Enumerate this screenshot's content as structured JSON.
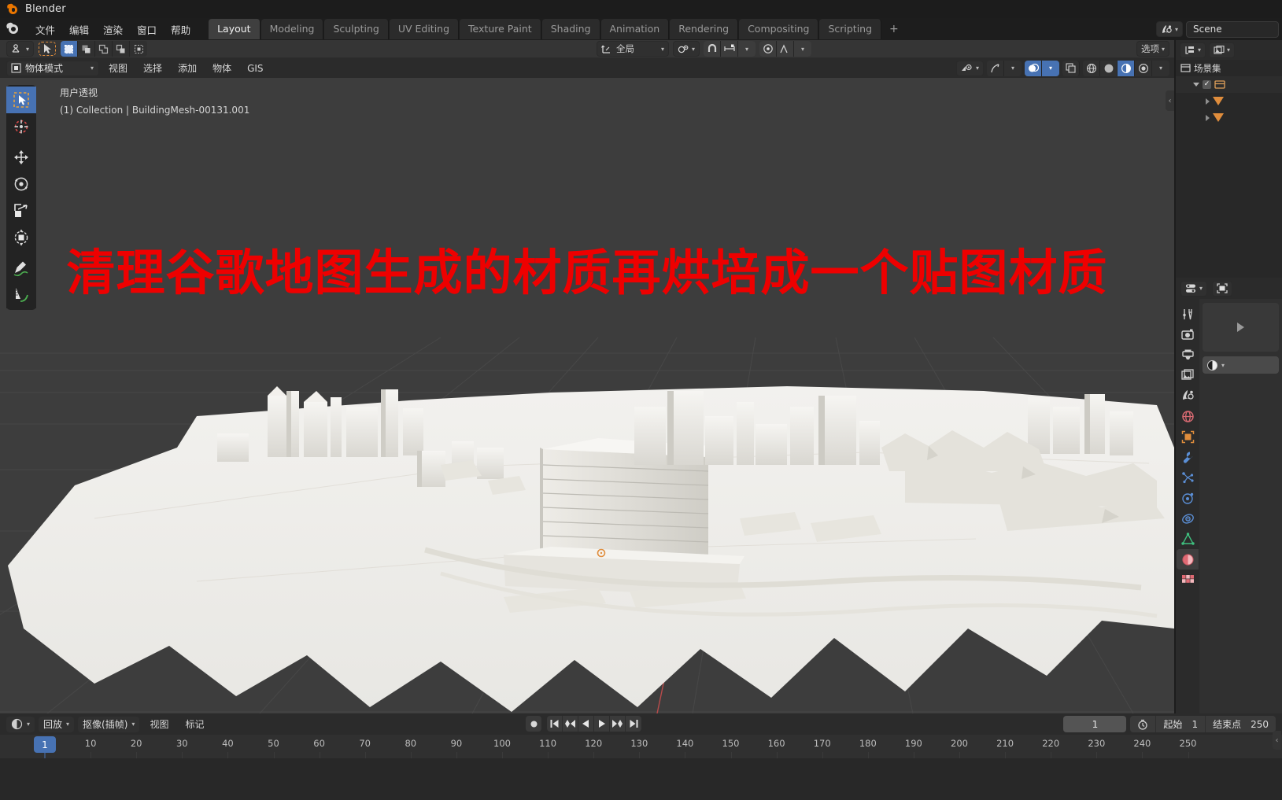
{
  "window": {
    "title": "Blender",
    "logo_icon": "blender-logo-icon"
  },
  "topbar": {
    "menus": [
      "文件",
      "编辑",
      "渲染",
      "窗口",
      "帮助"
    ],
    "workspace_tabs": [
      {
        "label": "Layout",
        "active": true
      },
      {
        "label": "Modeling",
        "active": false
      },
      {
        "label": "Sculpting",
        "active": false
      },
      {
        "label": "UV Editing",
        "active": false
      },
      {
        "label": "Texture Paint",
        "active": false
      },
      {
        "label": "Shading",
        "active": false
      },
      {
        "label": "Animation",
        "active": false
      },
      {
        "label": "Rendering",
        "active": false
      },
      {
        "label": "Compositing",
        "active": false
      },
      {
        "label": "Scripting",
        "active": false
      }
    ],
    "add_tab_label": "+",
    "scene_browse_icon": "scene-data-icon",
    "scene_name": "Scene"
  },
  "viewport": {
    "tool_settings": {
      "active_tool_icon": "tweak-tool-icon",
      "select_modes": [
        "select-new-icon",
        "select-extend-icon",
        "select-subtract-icon",
        "select-invert-icon",
        "select-intersect-icon"
      ],
      "transform_orientation": "全局",
      "transform_orientation_icon": "orientation-axis-icon",
      "pivot_icon": "pivot-point-icon",
      "snap_icon": "magnet-icon",
      "snap_to_icon": "snap-increment-icon",
      "proportional_icon": "proportional-edit-icon",
      "falloff_icon": "falloff-curve-icon",
      "options_label": "选项"
    },
    "header": {
      "mode": "物体模式",
      "mode_icon": "object-mode-icon",
      "menus": [
        "视图",
        "选择",
        "添加",
        "物体",
        "GIS"
      ],
      "visibility_icon": "eye-dropdown-icon",
      "gizmo_icon": "gizmo-icon",
      "overlays_icon": "overlays-icon",
      "xray_icon": "xray-toggle-icon",
      "shading_modes": [
        "wireframe-shading-icon",
        "solid-shading-icon",
        "material-shading-icon",
        "rendered-shading-icon"
      ],
      "active_shading": "material-shading-icon"
    },
    "toolbar": [
      {
        "icon": "select-box-tool-icon",
        "active": true
      },
      {
        "icon": "cursor-tool-icon",
        "active": false
      },
      {
        "icon": "move-tool-icon",
        "active": false
      },
      {
        "icon": "rotate-tool-icon",
        "active": false
      },
      {
        "icon": "scale-tool-icon",
        "active": false
      },
      {
        "icon": "transform-tool-icon",
        "active": false
      },
      {
        "icon": "annotate-tool-icon",
        "active": false
      },
      {
        "icon": "measure-tool-icon",
        "active": false
      }
    ],
    "info_line1": "用户透视",
    "info_line2": "(1) Collection | BuildingMesh-00131.001",
    "overlay_title": "清理谷歌地图生成的材质再烘培成一个贴图材质",
    "overlay_title_color": "#ee0000",
    "background_color": "#3d3d3d",
    "collapse_arrow": "‹"
  },
  "outliner": {
    "display_mode_icon": "outliner-display-icon",
    "filter_icon": "outliner-filter-icon",
    "root_icon": "scene-collection-icon",
    "root_label": "场景集",
    "rows": [
      {
        "icon": "collection-icon",
        "label": "",
        "checkbox": true,
        "expanded": true
      },
      {
        "icon": "mesh-object-icon",
        "label": "",
        "checkbox": false,
        "expanded": false
      },
      {
        "icon": "mesh-object-icon",
        "label": "",
        "checkbox": false,
        "expanded": false
      }
    ]
  },
  "properties": {
    "browse_icon": "editor-type-icon",
    "fullscreen_icon": "maximize-icon",
    "tabs": [
      {
        "icon": "tool-properties-icon",
        "active": false
      },
      {
        "icon": "render-properties-icon",
        "active": false
      },
      {
        "icon": "output-properties-icon",
        "active": false
      },
      {
        "icon": "view-layer-properties-icon",
        "active": false
      },
      {
        "icon": "scene-properties-icon",
        "active": false
      },
      {
        "icon": "world-properties-icon",
        "active": false
      },
      {
        "icon": "object-properties-icon",
        "active": false
      },
      {
        "icon": "modifier-properties-icon",
        "active": false
      },
      {
        "icon": "particle-properties-icon",
        "active": false
      },
      {
        "icon": "physics-properties-icon",
        "active": false
      },
      {
        "icon": "constraint-properties-icon",
        "active": false
      },
      {
        "icon": "data-properties-icon",
        "active": false
      },
      {
        "icon": "material-properties-icon",
        "active": true
      },
      {
        "icon": "texture-properties-icon",
        "active": false
      }
    ],
    "preview_play_icon": "preview-play-icon",
    "material_browse_icon": "material-browse-icon"
  },
  "timeline": {
    "editor_icon": "timeline-editor-icon",
    "playback_label": "回放",
    "keying_label": "抠像(插帧)",
    "view_label": "视图",
    "marker_label": "标记",
    "playback_buttons": [
      "record-icon",
      "jump-to-start-icon",
      "prev-keyframe-icon",
      "play-reverse-icon",
      "play-icon",
      "next-keyframe-icon",
      "jump-to-end-icon"
    ],
    "current_frame": "1",
    "timer_icon": "auto-key-icon",
    "start_label": "起始",
    "start_value": "1",
    "end_label": "结束点",
    "end_value": "250",
    "ruler_ticks": [
      "10",
      "20",
      "30",
      "40",
      "50",
      "60",
      "70",
      "80",
      "90",
      "100",
      "110",
      "120",
      "130",
      "140",
      "150",
      "160",
      "170",
      "180",
      "190",
      "200",
      "210",
      "220",
      "230",
      "240",
      "250"
    ],
    "playhead_label": "1",
    "collapse_arrow": "‹"
  }
}
